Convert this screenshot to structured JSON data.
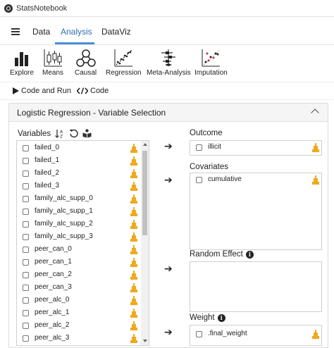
{
  "app": {
    "title": "StatsNotebook"
  },
  "nav": {
    "tabs": [
      "Data",
      "Analysis",
      "DataViz"
    ],
    "active": "Analysis"
  },
  "toolbar": {
    "items": [
      {
        "label": "Explore",
        "icon": "bar-chart-icon"
      },
      {
        "label": "Means",
        "icon": "boxplot-icon"
      },
      {
        "label": "Causal",
        "icon": "causal-graph-icon"
      },
      {
        "label": "Regression",
        "icon": "scatter-regression-icon"
      },
      {
        "label": "Meta-Analysis",
        "icon": "forest-plot-icon"
      },
      {
        "label": "Imputation",
        "icon": "imputation-scatter-icon"
      }
    ]
  },
  "codebar": {
    "code_and_run": "Code and Run",
    "code": "Code"
  },
  "panel": {
    "title": "Logistic Regression - Variable Selection"
  },
  "variables": {
    "label": "Variables",
    "items": [
      "failed_0",
      "failed_1",
      "failed_2",
      "failed_3",
      "family_alc_supp_0",
      "family_alc_supp_1",
      "family_alc_supp_2",
      "family_alc_supp_3",
      "peer_can_0",
      "peer_can_1",
      "peer_can_2",
      "peer_can_3",
      "peer_alc_0",
      "peer_alc_1",
      "peer_alc_2",
      "peer_alc_3"
    ]
  },
  "outcome": {
    "label": "Outcome",
    "items": [
      "illicit"
    ]
  },
  "covariates": {
    "label": "Covariates",
    "items": [
      "cumulative"
    ]
  },
  "random_effect": {
    "label": "Random Effect",
    "items": []
  },
  "weight": {
    "label": "Weight",
    "items": [
      ".final_weight"
    ]
  },
  "colors": {
    "accent": "#2b6fb6",
    "histogram": "#f0a81c"
  }
}
